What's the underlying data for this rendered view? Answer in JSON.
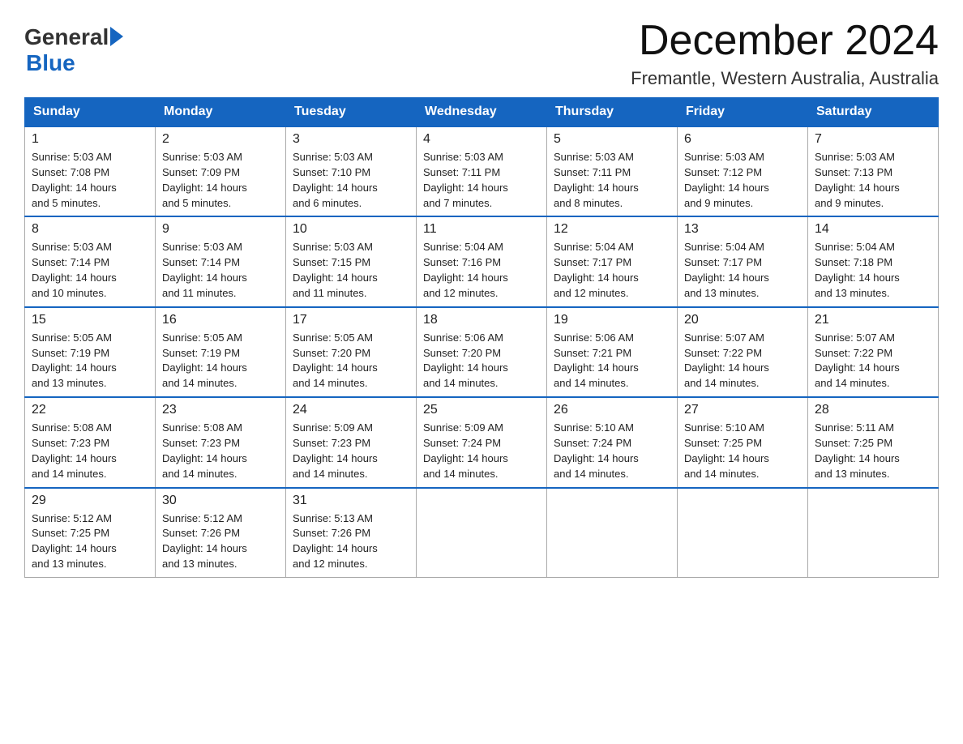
{
  "logo": {
    "general": "General",
    "arrow": "▶",
    "blue": "Blue"
  },
  "title": "December 2024",
  "subtitle": "Fremantle, Western Australia, Australia",
  "days_of_week": [
    "Sunday",
    "Monday",
    "Tuesday",
    "Wednesday",
    "Thursday",
    "Friday",
    "Saturday"
  ],
  "weeks": [
    [
      {
        "day": 1,
        "sunrise": "5:03 AM",
        "sunset": "7:08 PM",
        "daylight": "14 hours and 5 minutes."
      },
      {
        "day": 2,
        "sunrise": "5:03 AM",
        "sunset": "7:09 PM",
        "daylight": "14 hours and 5 minutes."
      },
      {
        "day": 3,
        "sunrise": "5:03 AM",
        "sunset": "7:10 PM",
        "daylight": "14 hours and 6 minutes."
      },
      {
        "day": 4,
        "sunrise": "5:03 AM",
        "sunset": "7:11 PM",
        "daylight": "14 hours and 7 minutes."
      },
      {
        "day": 5,
        "sunrise": "5:03 AM",
        "sunset": "7:11 PM",
        "daylight": "14 hours and 8 minutes."
      },
      {
        "day": 6,
        "sunrise": "5:03 AM",
        "sunset": "7:12 PM",
        "daylight": "14 hours and 9 minutes."
      },
      {
        "day": 7,
        "sunrise": "5:03 AM",
        "sunset": "7:13 PM",
        "daylight": "14 hours and 9 minutes."
      }
    ],
    [
      {
        "day": 8,
        "sunrise": "5:03 AM",
        "sunset": "7:14 PM",
        "daylight": "14 hours and 10 minutes."
      },
      {
        "day": 9,
        "sunrise": "5:03 AM",
        "sunset": "7:14 PM",
        "daylight": "14 hours and 11 minutes."
      },
      {
        "day": 10,
        "sunrise": "5:03 AM",
        "sunset": "7:15 PM",
        "daylight": "14 hours and 11 minutes."
      },
      {
        "day": 11,
        "sunrise": "5:04 AM",
        "sunset": "7:16 PM",
        "daylight": "14 hours and 12 minutes."
      },
      {
        "day": 12,
        "sunrise": "5:04 AM",
        "sunset": "7:17 PM",
        "daylight": "14 hours and 12 minutes."
      },
      {
        "day": 13,
        "sunrise": "5:04 AM",
        "sunset": "7:17 PM",
        "daylight": "14 hours and 13 minutes."
      },
      {
        "day": 14,
        "sunrise": "5:04 AM",
        "sunset": "7:18 PM",
        "daylight": "14 hours and 13 minutes."
      }
    ],
    [
      {
        "day": 15,
        "sunrise": "5:05 AM",
        "sunset": "7:19 PM",
        "daylight": "14 hours and 13 minutes."
      },
      {
        "day": 16,
        "sunrise": "5:05 AM",
        "sunset": "7:19 PM",
        "daylight": "14 hours and 14 minutes."
      },
      {
        "day": 17,
        "sunrise": "5:05 AM",
        "sunset": "7:20 PM",
        "daylight": "14 hours and 14 minutes."
      },
      {
        "day": 18,
        "sunrise": "5:06 AM",
        "sunset": "7:20 PM",
        "daylight": "14 hours and 14 minutes."
      },
      {
        "day": 19,
        "sunrise": "5:06 AM",
        "sunset": "7:21 PM",
        "daylight": "14 hours and 14 minutes."
      },
      {
        "day": 20,
        "sunrise": "5:07 AM",
        "sunset": "7:22 PM",
        "daylight": "14 hours and 14 minutes."
      },
      {
        "day": 21,
        "sunrise": "5:07 AM",
        "sunset": "7:22 PM",
        "daylight": "14 hours and 14 minutes."
      }
    ],
    [
      {
        "day": 22,
        "sunrise": "5:08 AM",
        "sunset": "7:23 PM",
        "daylight": "14 hours and 14 minutes."
      },
      {
        "day": 23,
        "sunrise": "5:08 AM",
        "sunset": "7:23 PM",
        "daylight": "14 hours and 14 minutes."
      },
      {
        "day": 24,
        "sunrise": "5:09 AM",
        "sunset": "7:23 PM",
        "daylight": "14 hours and 14 minutes."
      },
      {
        "day": 25,
        "sunrise": "5:09 AM",
        "sunset": "7:24 PM",
        "daylight": "14 hours and 14 minutes."
      },
      {
        "day": 26,
        "sunrise": "5:10 AM",
        "sunset": "7:24 PM",
        "daylight": "14 hours and 14 minutes."
      },
      {
        "day": 27,
        "sunrise": "5:10 AM",
        "sunset": "7:25 PM",
        "daylight": "14 hours and 14 minutes."
      },
      {
        "day": 28,
        "sunrise": "5:11 AM",
        "sunset": "7:25 PM",
        "daylight": "14 hours and 13 minutes."
      }
    ],
    [
      {
        "day": 29,
        "sunrise": "5:12 AM",
        "sunset": "7:25 PM",
        "daylight": "14 hours and 13 minutes."
      },
      {
        "day": 30,
        "sunrise": "5:12 AM",
        "sunset": "7:26 PM",
        "daylight": "14 hours and 13 minutes."
      },
      {
        "day": 31,
        "sunrise": "5:13 AM",
        "sunset": "7:26 PM",
        "daylight": "14 hours and 12 minutes."
      },
      null,
      null,
      null,
      null
    ]
  ],
  "labels": {
    "sunrise": "Sunrise:",
    "sunset": "Sunset:",
    "daylight": "Daylight:"
  }
}
